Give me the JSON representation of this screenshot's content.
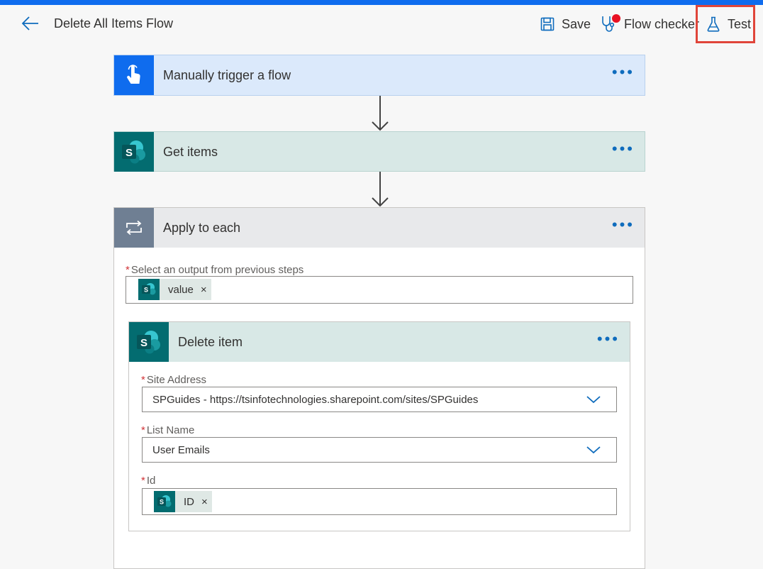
{
  "header": {
    "title": "Delete All Items Flow",
    "save_label": "Save",
    "checker_label": "Flow checker",
    "test_label": "Test",
    "accent_color": "#0f6cee"
  },
  "steps": {
    "trigger": {
      "title": "Manually trigger a flow",
      "icon": "touch-hand-icon"
    },
    "get_items": {
      "title": "Get items",
      "icon": "sharepoint-icon"
    },
    "apply": {
      "title": "Apply to each",
      "icon": "loop-icon",
      "output_label": "Select an output from previous steps",
      "output_token": "value"
    },
    "delete_item": {
      "title": "Delete item",
      "icon": "sharepoint-icon",
      "site_label": "Site Address",
      "site_value": "SPGuides - https://tsinfotechnologies.sharepoint.com/sites/SPGuides",
      "list_label": "List Name",
      "list_value": "User Emails",
      "id_label": "Id",
      "id_token": "ID"
    }
  },
  "common": {
    "more": "•••",
    "required_mark": "*",
    "remove": "×"
  }
}
